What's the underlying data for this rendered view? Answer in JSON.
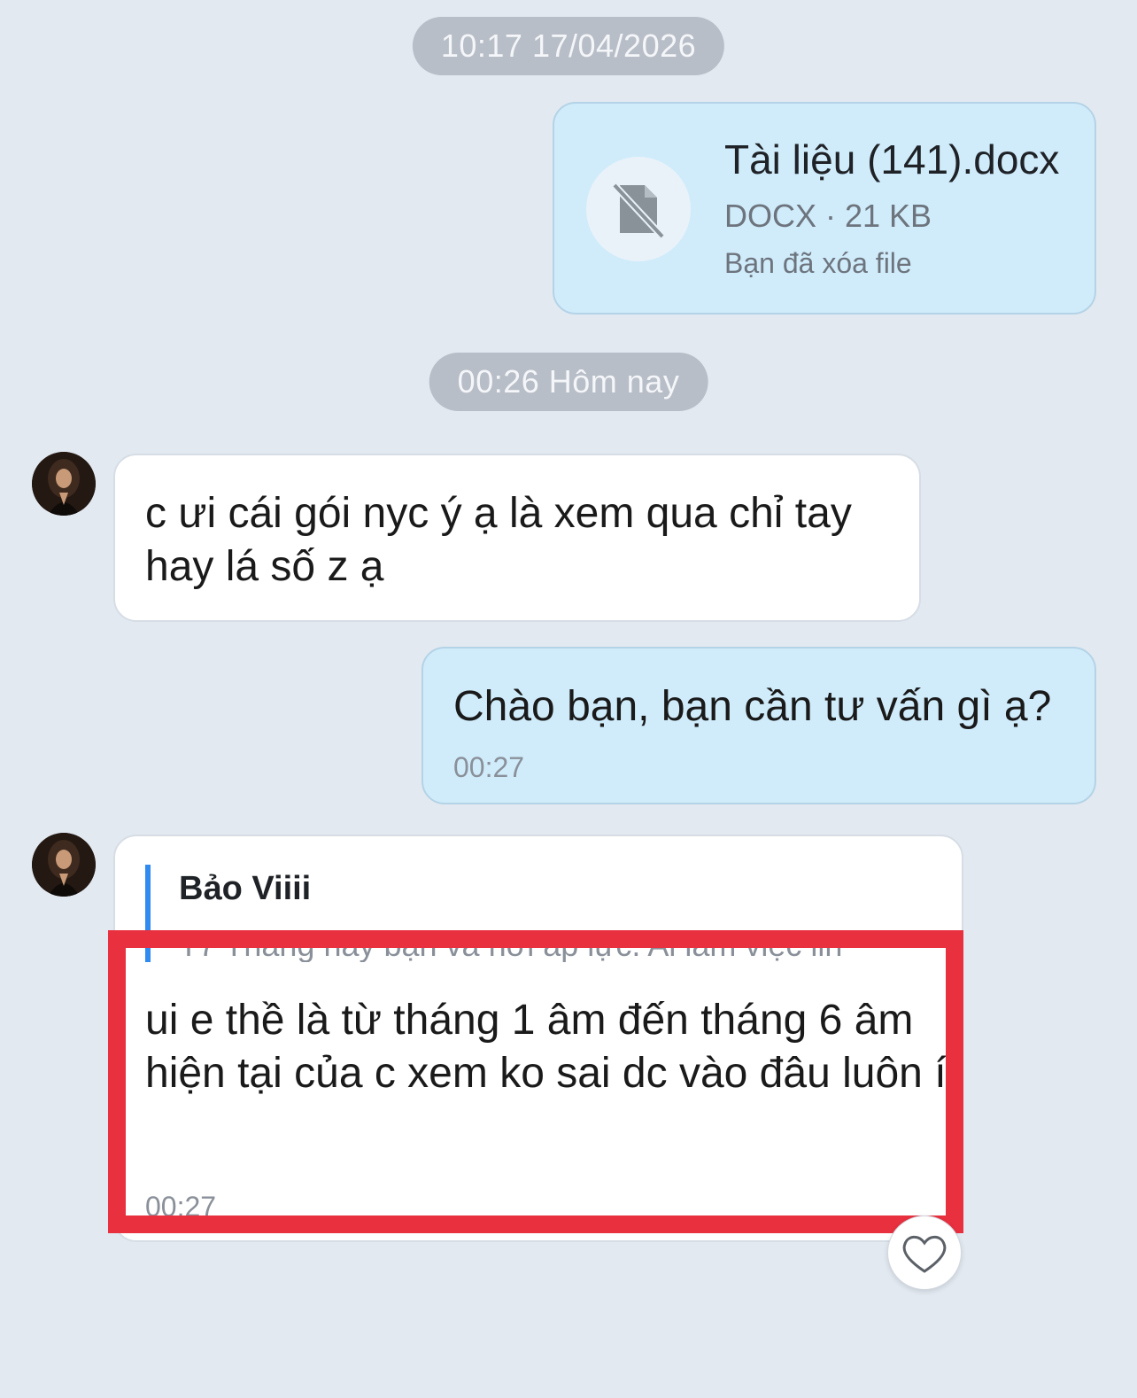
{
  "timestamps": {
    "first": "10:17 17/04/2026",
    "second": "00:26 Hôm nay"
  },
  "file_message": {
    "file_name": "Tài liệu (141).docx",
    "file_meta": "DOCX · 21 KB",
    "status": "Bạn đã xóa file",
    "icon": "deleted-file-icon"
  },
  "messages": [
    {
      "sender": "them",
      "text": "c ưi cái gói nyc ý ạ là xem qua chỉ tay hay lá số z ạ"
    },
    {
      "sender": "me",
      "text": "Chào bạn, bạn cần tư vấn gì ạ?",
      "time": "00:27"
    },
    {
      "sender": "them",
      "quote_name": "Bảo Viiii",
      "quote_snippet": "T7 Tháng này bận và hơi áp lực. Ai làm việc lin",
      "text": "ui e thề là từ tháng 1 âm đến tháng 6 âm hiện tại của c xem ko sai dc vào đâu luôn í",
      "time": "00:27"
    }
  ],
  "colors": {
    "background": "#e2e9f1",
    "my_bubble": "#d0ecfb",
    "their_bubble": "#ffffff",
    "quote_bar": "#2f8bf0",
    "highlight": "#e8303f"
  },
  "icons": {
    "reaction": "heart-icon",
    "avatar": "contact-avatar"
  }
}
